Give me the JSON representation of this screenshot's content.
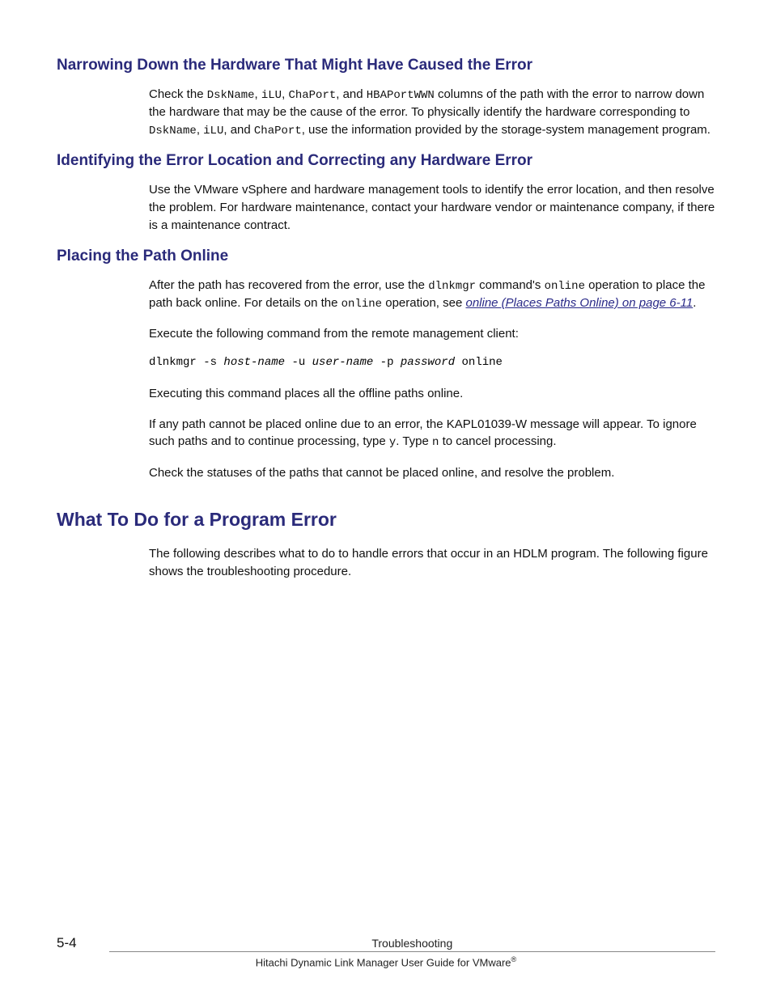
{
  "sections": {
    "narrowing": {
      "heading": "Narrowing Down the Hardware That Might Have Caused the Error",
      "p1_a": "Check the ",
      "p1_code1": "DskName",
      "p1_b": ", ",
      "p1_code2": "iLU",
      "p1_c": ", ",
      "p1_code3": "ChaPort",
      "p1_d": ", and ",
      "p1_code4": "HBAPortWWN",
      "p1_e": " columns of the path with the error to narrow down the hardware that may be the cause of the error. To physically identify the hardware corresponding to ",
      "p1_code5": "DskName",
      "p1_f": ", ",
      "p1_code6": "iLU",
      "p1_g": ", and ",
      "p1_code7": "ChaPort",
      "p1_h": ", use the information provided by the storage-system management program."
    },
    "identifying": {
      "heading": "Identifying the Error Location and Correcting any Hardware Error",
      "p1": "Use the VMware vSphere and hardware management tools to identify the error location, and then resolve the problem. For hardware maintenance, contact your hardware vendor or maintenance company, if there is a maintenance contract."
    },
    "placing": {
      "heading": "Placing the Path Online",
      "p1_a": "After the path has recovered from the error, use the ",
      "p1_code1": "dlnkmgr",
      "p1_b": " command's ",
      "p1_code2": "online",
      "p1_c": " operation to place the path back online. For details on the ",
      "p1_code3": "online",
      "p1_d": " operation, see ",
      "p1_link": "online (Places Paths Online) on page 6-11",
      "p1_e": ".",
      "p2": "Execute the following command from the remote management client:",
      "cmd_a": "dlnkmgr -s ",
      "cmd_i1": "host-name",
      "cmd_b": " -u ",
      "cmd_i2": "user-name",
      "cmd_c": " -p ",
      "cmd_i3": "password",
      "cmd_d": " online",
      "p3": "Executing this command places all the offline paths online.",
      "p4_a": "If any path cannot be placed online due to an error, the KAPL01039-W message will appear. To ignore such paths and to continue processing, type ",
      "p4_code1": "y",
      "p4_b": ". Type ",
      "p4_code2": "n",
      "p4_c": " to cancel processing.",
      "p5": "Check the statuses of the paths that cannot be placed online, and resolve the problem."
    },
    "program_error": {
      "heading": "What To Do for a Program Error",
      "p1": "The following describes what to do to handle errors that occur in an HDLM program. The following figure shows the troubleshooting procedure."
    }
  },
  "footer": {
    "page": "5-4",
    "title": "Troubleshooting",
    "subtitle_a": "Hitachi Dynamic Link Manager User Guide for VMware",
    "subtitle_sup": "®"
  }
}
